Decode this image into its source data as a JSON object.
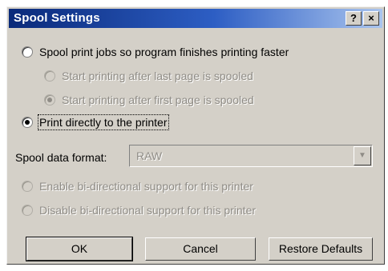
{
  "window": {
    "title": "Spool Settings",
    "help_button": "?",
    "close_button": "×"
  },
  "options": {
    "spool_jobs": {
      "label": "Spool print jobs so program finishes printing faster",
      "selected": false,
      "enabled": true
    },
    "start_after_last": {
      "label": "Start printing after last page is spooled",
      "selected": false,
      "enabled": false
    },
    "start_after_first": {
      "label": "Start printing after first page is spooled",
      "selected": true,
      "enabled": false
    },
    "print_directly": {
      "label": "Print directly to the printer",
      "selected": true,
      "enabled": true
    },
    "enable_bidi": {
      "label": "Enable bi-directional support for this printer",
      "selected": false,
      "enabled": false
    },
    "disable_bidi": {
      "label": "Disable bi-directional support for this printer",
      "selected": false,
      "enabled": false
    }
  },
  "spool_format": {
    "label": "Spool data format:",
    "value": "RAW",
    "enabled": false
  },
  "buttons": {
    "ok": "OK",
    "cancel": "Cancel",
    "restore_defaults": "Restore Defaults"
  }
}
